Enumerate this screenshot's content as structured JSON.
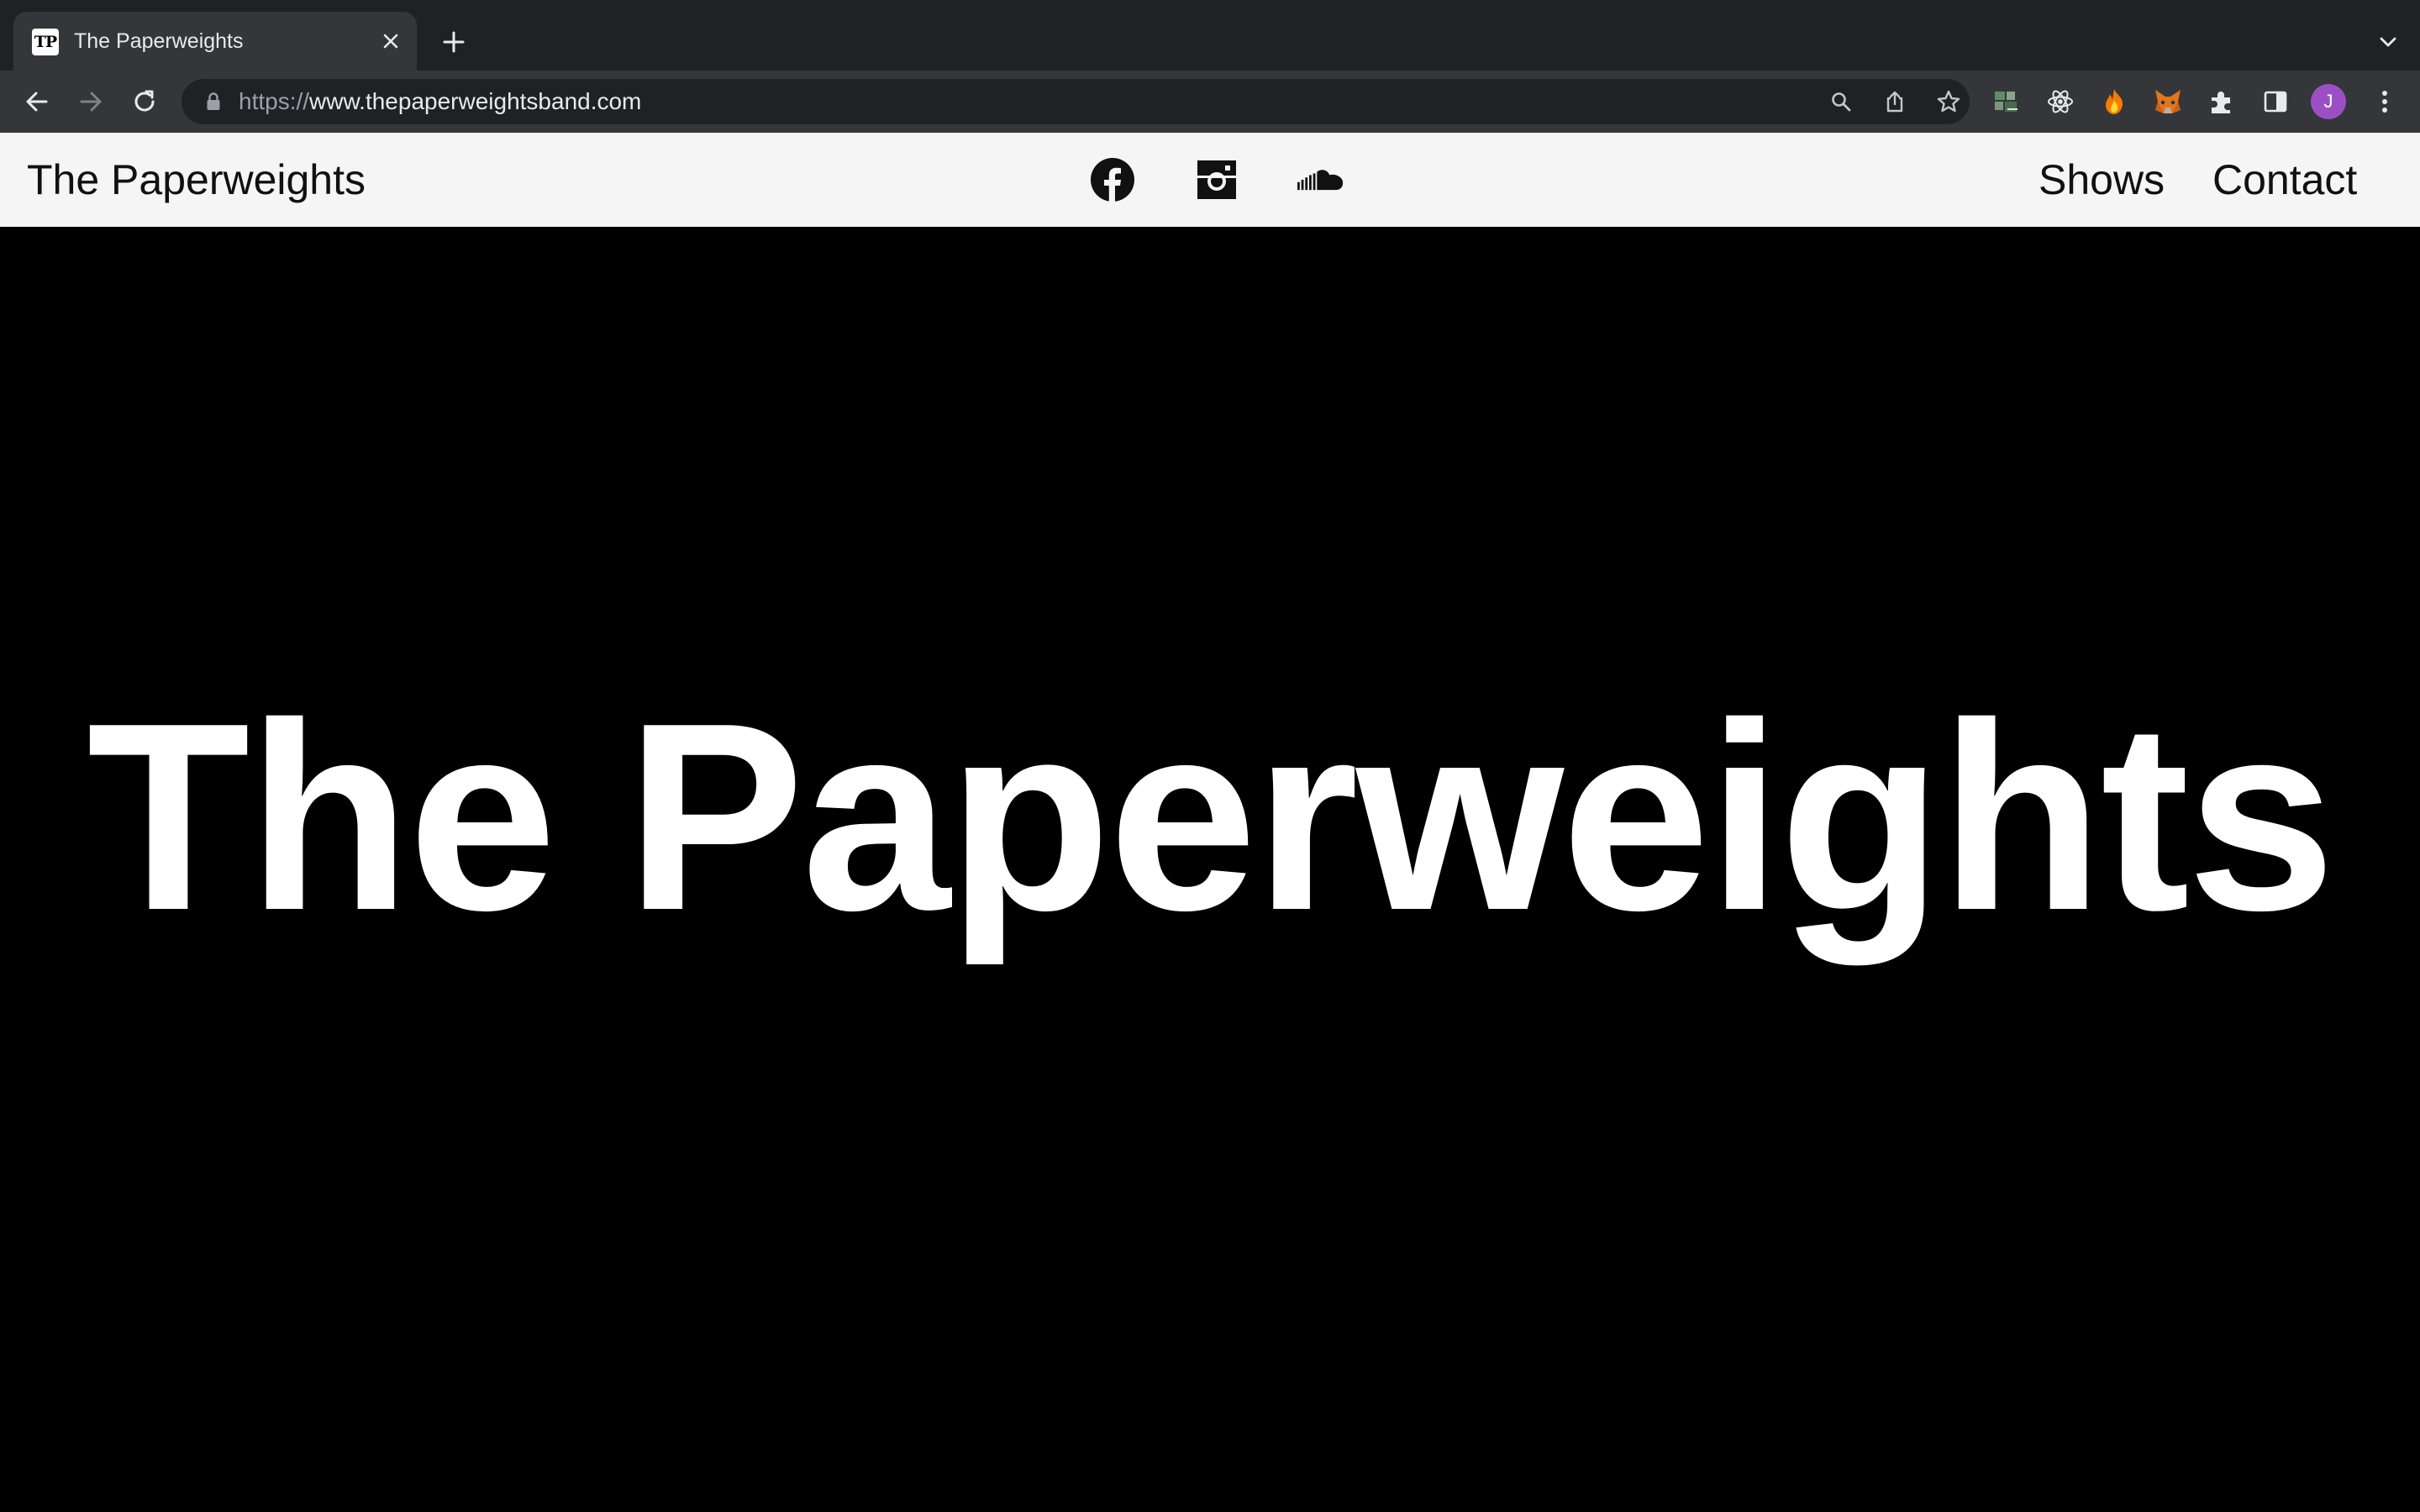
{
  "browser": {
    "tab": {
      "favicon_text": "TP",
      "title": "The Paperweights"
    },
    "address_bar": {
      "scheme": "https://",
      "host_path": "www.thepaperweightsband.com"
    },
    "profile_initial": "J"
  },
  "header": {
    "brand": "The Paperweights",
    "social_icons": [
      "facebook-icon",
      "instagram-icon",
      "soundcloud-icon"
    ],
    "nav": [
      {
        "label": "Shows"
      },
      {
        "label": "Contact"
      }
    ]
  },
  "hero": {
    "title": "The Paperweights"
  },
  "colors": {
    "tabstrip_bg": "#202124",
    "toolbar_bg": "#35363a",
    "header_bg": "#f5f5f5",
    "hero_bg": "#000000",
    "hero_text": "#ffffff",
    "avatar_bg": "#9c4fc4"
  }
}
